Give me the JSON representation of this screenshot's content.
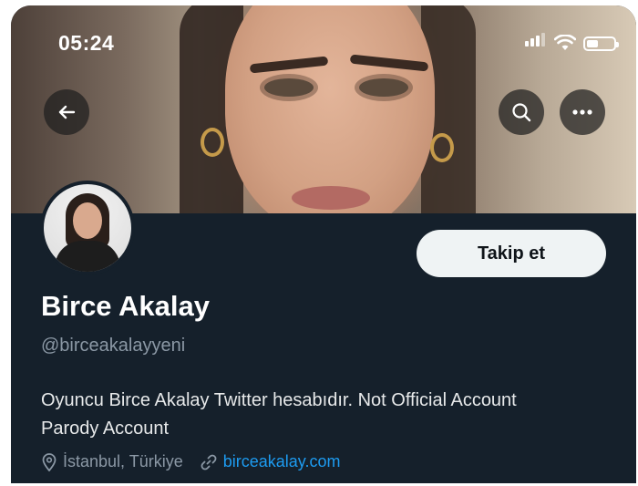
{
  "status_bar": {
    "time": "05:24"
  },
  "header": {
    "back_icon": "arrow-left-icon",
    "search_icon": "search-icon",
    "more_icon": "more-horizontal-icon"
  },
  "profile": {
    "follow_label": "Takip et",
    "name": "Birce Akalay",
    "handle": "@birceakalayyeni",
    "bio_line1": "Oyuncu Birce Akalay Twitter hesabıdır. Not Official Account",
    "bio_line2": "Parody Account",
    "location": "İstanbul, Türkiye",
    "website": "birceakalay.com"
  },
  "colors": {
    "background": "#15202b",
    "link": "#1d9bf0",
    "secondary_text": "#8b98a5",
    "follow_button_bg": "#eff3f4"
  }
}
